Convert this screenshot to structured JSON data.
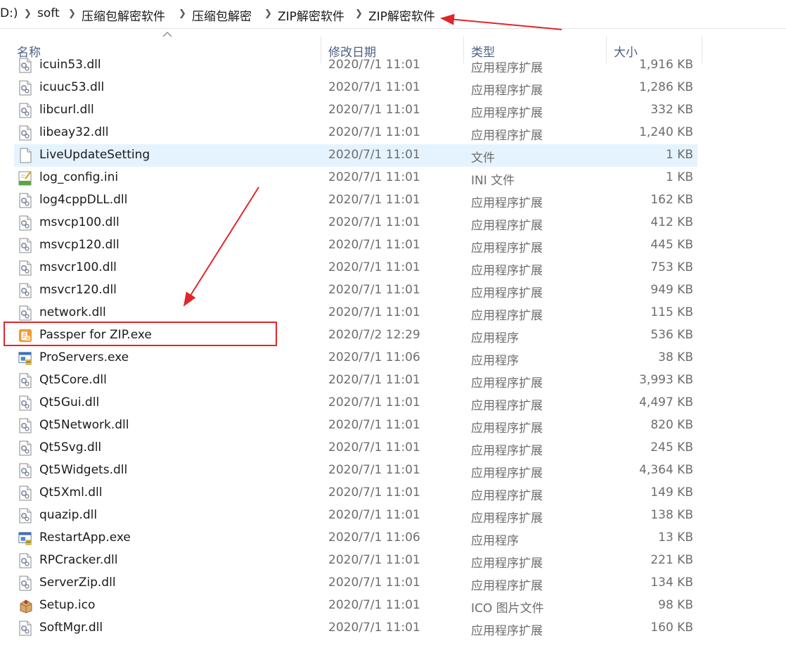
{
  "breadcrumb": {
    "items": [
      "D:)",
      "soft",
      "压缩包解密软件",
      "压缩包解密",
      "ZIP解密软件",
      "ZIP解密软件"
    ]
  },
  "columns": {
    "name": "名称",
    "date": "修改日期",
    "type": "类型",
    "size": "大小"
  },
  "files": [
    {
      "name": "icuin53.dll",
      "date": "2020/7/1 11:01",
      "type": "应用程序扩展",
      "size": "1,916 KB",
      "icon": "dll-icon"
    },
    {
      "name": "icuuc53.dll",
      "date": "2020/7/1 11:01",
      "type": "应用程序扩展",
      "size": "1,286 KB",
      "icon": "dll-icon"
    },
    {
      "name": "libcurl.dll",
      "date": "2020/7/1 11:01",
      "type": "应用程序扩展",
      "size": "332 KB",
      "icon": "dll-icon"
    },
    {
      "name": "libeay32.dll",
      "date": "2020/7/1 11:01",
      "type": "应用程序扩展",
      "size": "1,240 KB",
      "icon": "dll-icon"
    },
    {
      "name": "LiveUpdateSetting",
      "date": "2020/7/1 11:01",
      "type": "文件",
      "size": "1 KB",
      "icon": "blank-file-icon",
      "selected": true
    },
    {
      "name": "log_config.ini",
      "date": "2020/7/1 11:01",
      "type": "INI 文件",
      "size": "1 KB",
      "icon": "ini-file-icon"
    },
    {
      "name": "log4cppDLL.dll",
      "date": "2020/7/1 11:01",
      "type": "应用程序扩展",
      "size": "162 KB",
      "icon": "dll-icon"
    },
    {
      "name": "msvcp100.dll",
      "date": "2020/7/1 11:01",
      "type": "应用程序扩展",
      "size": "412 KB",
      "icon": "dll-icon"
    },
    {
      "name": "msvcp120.dll",
      "date": "2020/7/1 11:01",
      "type": "应用程序扩展",
      "size": "445 KB",
      "icon": "dll-icon"
    },
    {
      "name": "msvcr100.dll",
      "date": "2020/7/1 11:01",
      "type": "应用程序扩展",
      "size": "753 KB",
      "icon": "dll-icon"
    },
    {
      "name": "msvcr120.dll",
      "date": "2020/7/1 11:01",
      "type": "应用程序扩展",
      "size": "949 KB",
      "icon": "dll-icon"
    },
    {
      "name": "network.dll",
      "date": "2020/7/1 11:01",
      "type": "应用程序扩展",
      "size": "115 KB",
      "icon": "dll-icon"
    },
    {
      "name": "Passper for ZIP.exe",
      "date": "2020/7/2 12:29",
      "type": "应用程序",
      "size": "536 KB",
      "icon": "passper-app-icon"
    },
    {
      "name": "ProServers.exe",
      "date": "2020/7/1 11:06",
      "type": "应用程序",
      "size": "38 KB",
      "icon": "exe-icon"
    },
    {
      "name": "Qt5Core.dll",
      "date": "2020/7/1 11:01",
      "type": "应用程序扩展",
      "size": "3,993 KB",
      "icon": "dll-icon"
    },
    {
      "name": "Qt5Gui.dll",
      "date": "2020/7/1 11:01",
      "type": "应用程序扩展",
      "size": "4,497 KB",
      "icon": "dll-icon"
    },
    {
      "name": "Qt5Network.dll",
      "date": "2020/7/1 11:01",
      "type": "应用程序扩展",
      "size": "820 KB",
      "icon": "dll-icon"
    },
    {
      "name": "Qt5Svg.dll",
      "date": "2020/7/1 11:01",
      "type": "应用程序扩展",
      "size": "245 KB",
      "icon": "dll-icon"
    },
    {
      "name": "Qt5Widgets.dll",
      "date": "2020/7/1 11:01",
      "type": "应用程序扩展",
      "size": "4,364 KB",
      "icon": "dll-icon"
    },
    {
      "name": "Qt5Xml.dll",
      "date": "2020/7/1 11:01",
      "type": "应用程序扩展",
      "size": "149 KB",
      "icon": "dll-icon"
    },
    {
      "name": "quazip.dll",
      "date": "2020/7/1 11:01",
      "type": "应用程序扩展",
      "size": "138 KB",
      "icon": "dll-icon"
    },
    {
      "name": "RestartApp.exe",
      "date": "2020/7/1 11:06",
      "type": "应用程序",
      "size": "13 KB",
      "icon": "exe-icon"
    },
    {
      "name": "RPCracker.dll",
      "date": "2020/7/1 11:01",
      "type": "应用程序扩展",
      "size": "221 KB",
      "icon": "dll-icon"
    },
    {
      "name": "ServerZip.dll",
      "date": "2020/7/1 11:01",
      "type": "应用程序扩展",
      "size": "134 KB",
      "icon": "dll-icon"
    },
    {
      "name": "Setup.ico",
      "date": "2020/7/1 11:01",
      "type": "ICO 图片文件",
      "size": "98 KB",
      "icon": "ico-file-icon"
    },
    {
      "name": "SoftMgr.dll",
      "date": "2020/7/1 11:01",
      "type": "应用程序扩展",
      "size": "160 KB",
      "icon": "dll-icon"
    }
  ],
  "annotation_color": "#e0262b",
  "selection_color": "#e5f3ff"
}
